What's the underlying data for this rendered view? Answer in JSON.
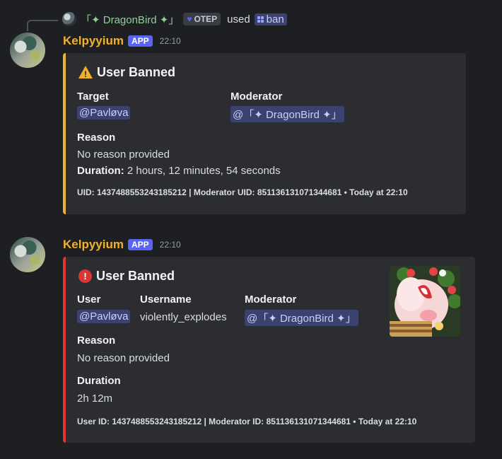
{
  "reply": {
    "name": "「✦ DragonBird ✦」",
    "tag_heart": "♥",
    "tag_text": "OTEP",
    "used_text": "used",
    "command": "ban"
  },
  "messages": [
    {
      "author": "Kelpyyium",
      "badge": "APP",
      "time": "22:10",
      "embed": {
        "icon": "warning-icon",
        "title": "User Banned",
        "fields": {
          "target_label": "Target",
          "target_value": "@Pavløva",
          "moderator_label": "Moderator",
          "moderator_value": "@「✦ DragonBird ✦」",
          "reason_label": "Reason",
          "reason_value": "No reason provided",
          "duration_label": "Duration:",
          "duration_value": "2 hours, 12 minutes, 54 seconds"
        },
        "footer": "UID: 1437488553243185212 | Moderator UID: 851136131071344681 • Today at 22:10",
        "accent": "#f0b132"
      }
    },
    {
      "author": "Kelpyyium",
      "badge": "APP",
      "time": "22:10",
      "embed": {
        "icon": "error-icon",
        "title": "User Banned",
        "fields": {
          "user_label": "User",
          "user_value": "@Pavløva",
          "username_label": "Username",
          "username_value": "violently_explodes",
          "moderator_label": "Moderator",
          "moderator_value": "@「✦ DragonBird ✦」",
          "reason_label": "Reason",
          "reason_value": "No reason provided",
          "duration_label": "Duration",
          "duration_value": "2h 12m"
        },
        "footer": "User ID: 1437488553243185212 | Moderator ID: 851136131071344681 • Today at 22:10",
        "accent": "#da3633"
      }
    }
  ]
}
